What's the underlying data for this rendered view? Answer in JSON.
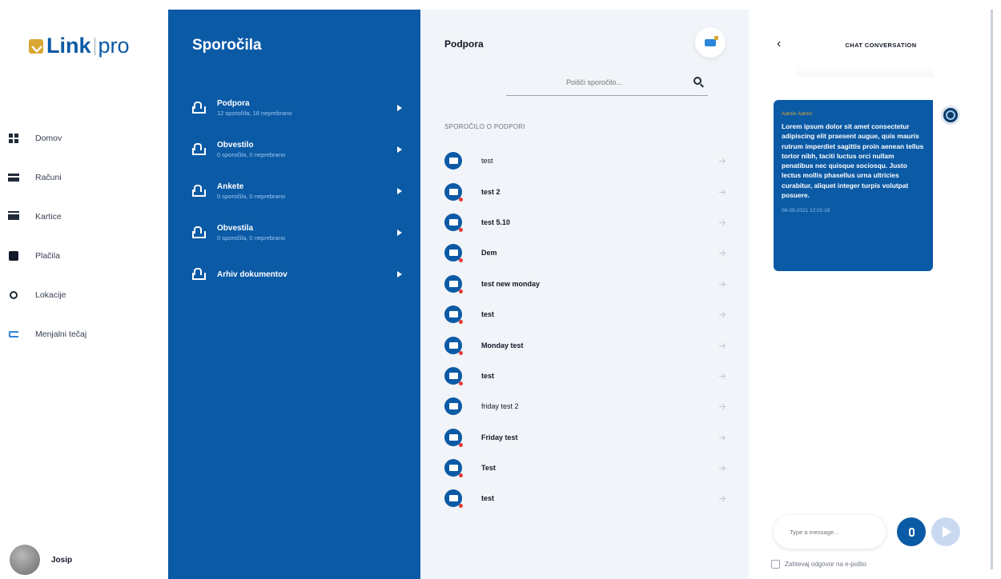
{
  "nav": {
    "logo_link": "Link",
    "logo_pro": "pro",
    "items": [
      {
        "label": "Domov",
        "icon": "grid-icon"
      },
      {
        "label": "Računi",
        "icon": "list-icon"
      },
      {
        "label": "Kartice",
        "icon": "card-icon"
      },
      {
        "label": "Plačila",
        "icon": "wallet-icon"
      },
      {
        "label": "Lokacije",
        "icon": "location-icon"
      },
      {
        "label": "Menjalni tečaj",
        "icon": "exchange-icon"
      }
    ],
    "user_name": "Josip"
  },
  "categories": {
    "title": "Sporočila",
    "items": [
      {
        "name": "Podpora",
        "sub": "12 sporočila, 16 neprebrano"
      },
      {
        "name": "Obvestilo",
        "sub": "0 sporočila, 0 neprebrano"
      },
      {
        "name": "Ankete",
        "sub": "0 sporočila, 0 neprebrano"
      },
      {
        "name": "Obvestila",
        "sub": "0 sporočila, 0 neprebrano"
      },
      {
        "name": "Arhiv dokumentov",
        "sub": ""
      }
    ]
  },
  "messages": {
    "title": "Podpora",
    "search_placeholder": "Poišči sporočilo...",
    "section_label": "SPOROČILO O PODPORI",
    "items": [
      {
        "subject": "test",
        "bold": false
      },
      {
        "subject": "test 2",
        "bold": true
      },
      {
        "subject": "test 5.10",
        "bold": true
      },
      {
        "subject": "Dem",
        "bold": true
      },
      {
        "subject": "test new monday",
        "bold": true
      },
      {
        "subject": "test",
        "bold": true
      },
      {
        "subject": "Monday test",
        "bold": true
      },
      {
        "subject": "test",
        "bold": true
      },
      {
        "subject": "friday test 2",
        "bold": false
      },
      {
        "subject": "Friday test",
        "bold": true
      },
      {
        "subject": "Test",
        "bold": true
      },
      {
        "subject": "test",
        "bold": true
      }
    ]
  },
  "chat": {
    "back": "‹",
    "title": "CHAT CONVERSATION",
    "message": {
      "sender": "Admin Admin",
      "text": "Lorem ipsum dolor sit amet consectetur adipiscing elit praesent augue, quis mauris rutrum imperdiet sagittis proin aenean tellus tortor nibh, taciti luctus orci nullam penatibus nec quisque sociosqu. Justo lectus mollis phasellus urna ultricies curabitur, aliquet integer turpis volutpat posuere.",
      "time": "06-09-2021 12:01:18"
    },
    "input_placeholder": "Type a message...",
    "email_option": "Zahtevaj odgovor na e-pošto"
  },
  "colors": {
    "brand": "#0b5aa5",
    "accent": "#d9a733",
    "panel_bg": "#f1f4f8",
    "unread_dot": "#e53935"
  }
}
